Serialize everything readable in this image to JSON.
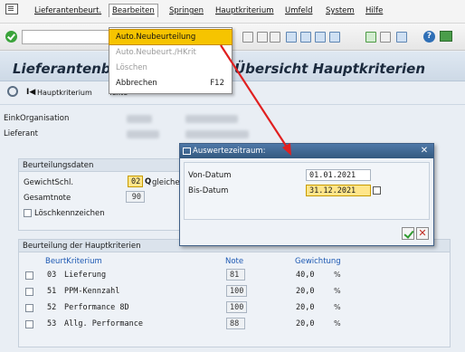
{
  "menubar": {
    "items": [
      "Lieferantenbeurt.",
      "Bearbeiten",
      "Springen",
      "Hauptkriterium",
      "Umfeld",
      "System",
      "Hilfe"
    ]
  },
  "title": {
    "left": "Lieferantenb",
    "right": "Übersicht Hauptkriterien"
  },
  "apptoolbar": {
    "hauptkriterium": "Hauptkriterium",
    "texte": "Texte"
  },
  "header": {
    "einkorg_label": "EinkOrganisation",
    "lieferant_label": "Lieferant"
  },
  "beurteilungsdaten": {
    "title": "Beurteilungsdaten",
    "gewichtschl_label": "GewichtSchl.",
    "gewichtschl_value": "02",
    "gewichtschl_text": "gleiche",
    "gesamtnote_label": "Gesamtnote",
    "gesamtnote_value": "90",
    "loeschkz_label": "Löschkennzeichen"
  },
  "hauptkriterien": {
    "title": "Beurteilung der Hauptkriterien",
    "col_kriterium": "BeurtKriterium",
    "col_note": "Note",
    "col_gewichtung": "Gewichtung",
    "rows": [
      {
        "nr": "03",
        "name": "Lieferung",
        "note": "81",
        "gewichtung": "40,0",
        "unit": "%"
      },
      {
        "nr": "51",
        "name": "PPM-Kennzahl",
        "note": "100",
        "gewichtung": "20,0",
        "unit": "%"
      },
      {
        "nr": "52",
        "name": "Performance 8D",
        "note": "100",
        "gewichtung": "20,0",
        "unit": "%"
      },
      {
        "nr": "53",
        "name": "Allg. Performance",
        "note": "88",
        "gewichtung": "20,0",
        "unit": "%"
      }
    ]
  },
  "dropdown": {
    "items": [
      {
        "label": "Auto.Neubeurteilung",
        "shortcut": ""
      },
      {
        "label": "Auto.Neubeurt./HKrit",
        "shortcut": ""
      },
      {
        "label": "Löschen",
        "shortcut": ""
      },
      {
        "label": "Abbrechen",
        "shortcut": "F12"
      }
    ]
  },
  "dialog": {
    "title": "Auswertezeitraum:",
    "von_label": "Von-Datum",
    "von_value": "01.01.2021",
    "bis_label": "Bis-Datum",
    "bis_value": "31.12.2021"
  },
  "icons": {
    "help": "?",
    "first": "I◀",
    "close": "✕",
    "cancel": "✕"
  },
  "colors": {
    "selection": "#f6c400",
    "dialog_title": "#3f6896",
    "arrow": "#e02020"
  }
}
